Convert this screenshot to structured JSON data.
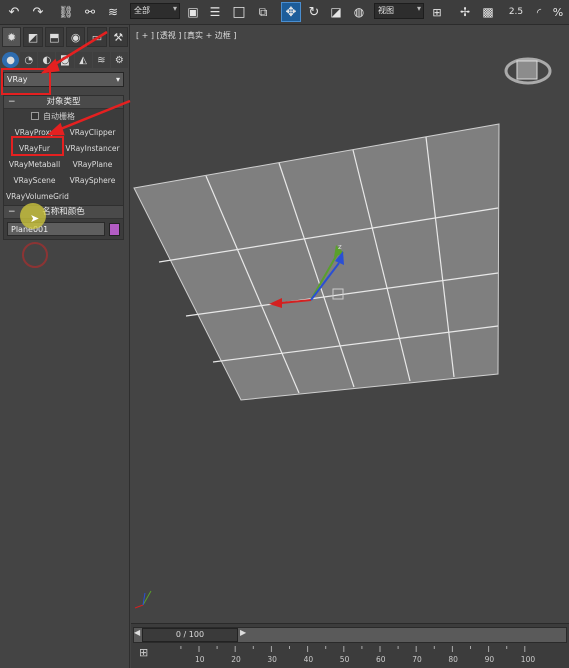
{
  "toolbar": {
    "undo_icon": "undo-icon",
    "redo_icon": "redo-icon",
    "selection_filter": "全部",
    "view_dropdown": "视图",
    "scale_value": "2.5"
  },
  "panel": {
    "category_value": "VRay",
    "object_type": {
      "title": "对象类型",
      "autogrid_label": "自动栅格",
      "buttons": [
        "VRayProxy",
        "VRayClipper",
        "VRayFur",
        "VRayInstancer",
        "VRayMetaball",
        "VRayPlane",
        "VRayScene",
        "VRaySphere",
        "VRayVolumeGrid"
      ]
    },
    "name_color": {
      "title": "名称和颜色",
      "name_value": "Plane001",
      "swatch_color": "#b35cc4"
    }
  },
  "viewport": {
    "label": "[ + ] [透视 ] [真实 + 边框 ]"
  },
  "timeline": {
    "frame_display": "0 / 100",
    "ticks": [
      "10",
      "20",
      "30",
      "40",
      "50",
      "60",
      "70",
      "80",
      "90",
      "100"
    ]
  },
  "colors": {
    "annotation_red": "#e52020",
    "selection_blue": "#2f6db0"
  }
}
